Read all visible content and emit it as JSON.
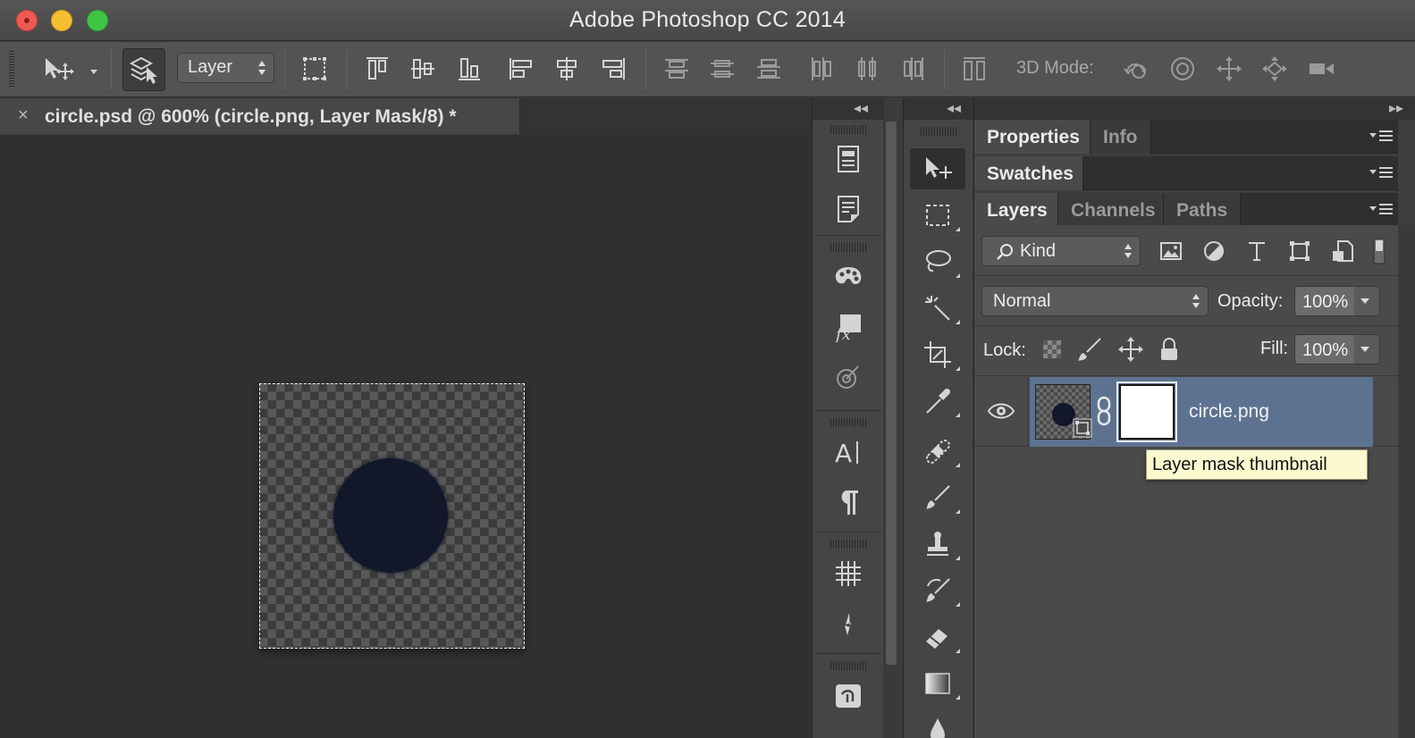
{
  "window": {
    "title": "Adobe Photoshop CC 2014"
  },
  "options_bar": {
    "auto_select_target": "Layer",
    "mode_3d_label": "3D Mode:",
    "align_icons": [
      "align-top-edges-icon",
      "align-vertical-centers-icon",
      "align-bottom-edges-icon",
      "align-left-edges-icon",
      "align-horizontal-centers-icon",
      "align-right-edges-icon"
    ],
    "distribute_icons": [
      "distribute-top-icon",
      "distribute-vertical-centers-icon",
      "distribute-bottom-icon",
      "distribute-left-icon",
      "distribute-horizontal-centers-icon",
      "distribute-right-icon",
      "auto-align-layers-icon"
    ],
    "mode_3d_icons": [
      "orbit-3d-icon",
      "roll-3d-icon",
      "pan-3d-icon",
      "slide-3d-icon",
      "scale-3d-icon"
    ]
  },
  "document": {
    "tab_label": "circle.psd @ 600% (circle.png, Layer Mask/8) *",
    "close_glyph": "×",
    "zoom_percent": 600
  },
  "dock": {
    "collapse_glyph": "◂◂",
    "expand_glyph": "▸▸",
    "groups": [
      [
        "history-panel-icon",
        "properties-panel-icon"
      ],
      [
        "swatches-panel-icon",
        "styles-panel-icon",
        "adjustments-panel-icon"
      ],
      [
        "character-panel-icon",
        "paragraph-panel-icon"
      ],
      [
        "grid-panel-icon",
        "brush-preset-icon"
      ],
      [
        "libraries-panel-icon"
      ]
    ]
  },
  "tools": [
    "move-tool-icon",
    "rectangular-marquee-icon",
    "lasso-icon",
    "magic-wand-icon",
    "crop-icon",
    "eyedropper-icon",
    "spot-healing-icon",
    "brush-icon",
    "clone-stamp-icon",
    "history-brush-icon",
    "eraser-icon",
    "gradient-icon",
    "blur-icon"
  ],
  "panels": {
    "group1_tabs": [
      "Properties",
      "Info"
    ],
    "group2_tabs": [
      "Swatches"
    ],
    "group3_tabs": [
      "Layers",
      "Channels",
      "Paths"
    ],
    "layers": {
      "filter_kind": "Kind",
      "blend_mode": "Normal",
      "opacity_label": "Opacity:",
      "opacity_value": "100%",
      "lock_label": "Lock:",
      "fill_label": "Fill:",
      "fill_value": "100%",
      "filter_icons": [
        "pixel-layer-filter-icon",
        "adjustment-layer-filter-icon",
        "type-layer-filter-icon",
        "shape-layer-filter-icon",
        "smart-object-filter-icon",
        "filter-toggle-icon"
      ],
      "lock_icons": [
        "lock-transparent-pixels-icon",
        "lock-image-pixels-icon",
        "lock-position-icon",
        "lock-all-icon"
      ],
      "rows": [
        {
          "name": "circle.png",
          "visible": true,
          "selected": true,
          "has_mask": true
        }
      ]
    }
  },
  "tooltip": {
    "text": "Layer mask thumbnail"
  },
  "colors": {
    "selection_row": "#5d7290",
    "canvas_circle": "#12172a",
    "tooltip_bg": "#fbf9d0"
  }
}
